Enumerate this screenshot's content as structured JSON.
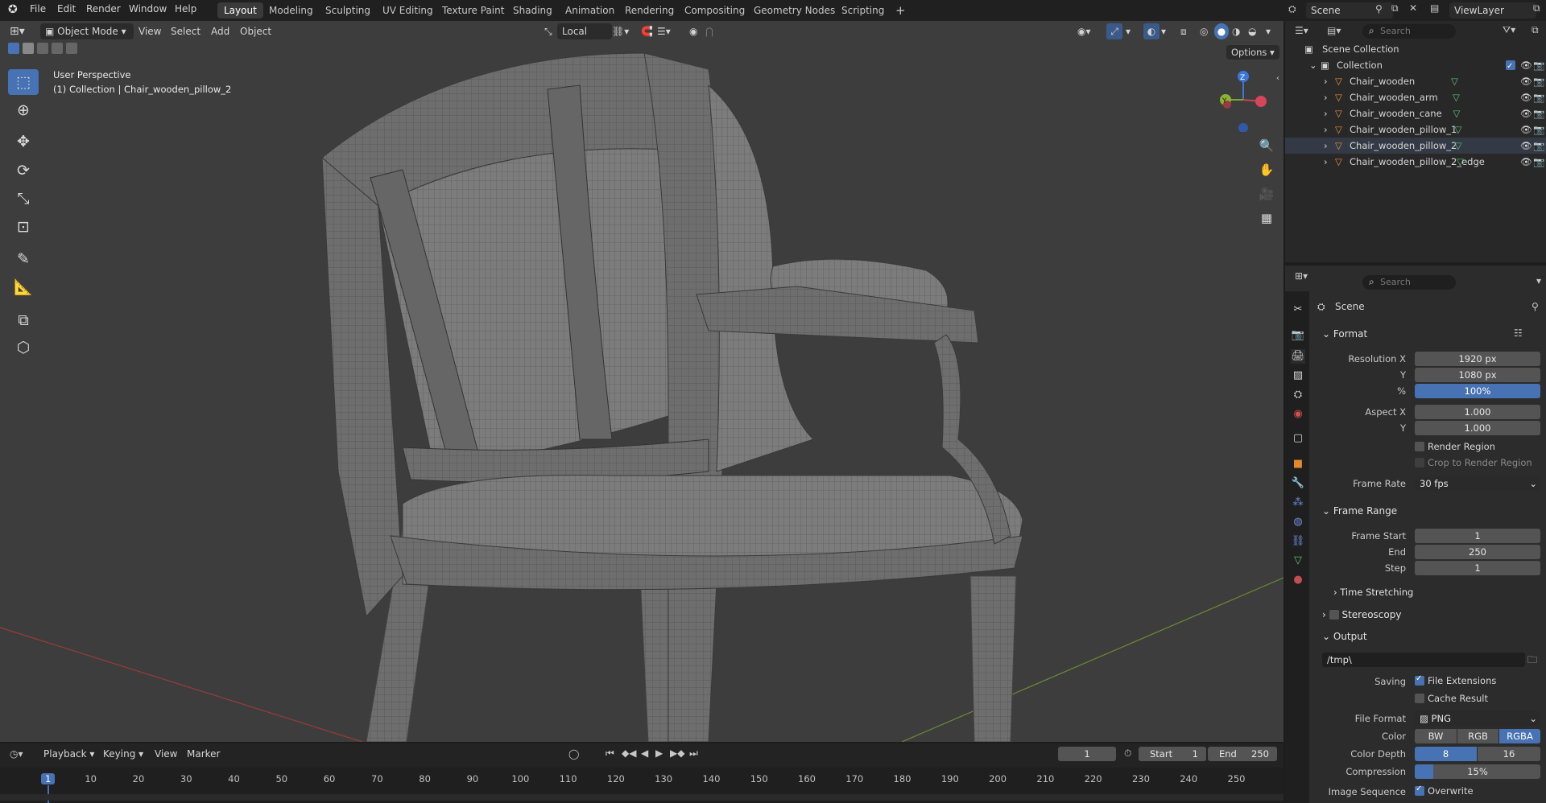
{
  "topbar": {
    "menus": [
      "File",
      "Edit",
      "Render",
      "Window",
      "Help"
    ],
    "workspaces": [
      "Layout",
      "Modeling",
      "Sculpting",
      "UV Editing",
      "Texture Paint",
      "Shading",
      "Animation",
      "Rendering",
      "Compositing",
      "Geometry Nodes",
      "Scripting"
    ],
    "active_workspace": "Layout",
    "add_tab": "+",
    "scene": "Scene",
    "view_layer": "ViewLayer"
  },
  "viewport": {
    "mode": "Object Mode",
    "menus": [
      "View",
      "Select",
      "Add",
      "Object"
    ],
    "transform_orientation": "Local",
    "options": "Options",
    "overlay_line1": "User Perspective",
    "overlay_line2": "(1) Collection | Chair_wooden_pillow_2",
    "gizmo_z": "Z",
    "gizmo_y": "Y"
  },
  "outliner": {
    "search_placeholder": "Search",
    "scene_collection": "Scene Collection",
    "collection": "Collection",
    "objects": [
      "Chair_wooden",
      "Chair_wooden_arm",
      "Chair_wooden_cane",
      "Chair_wooden_pillow_1",
      "Chair_wooden_pillow_2",
      "Chair_wooden_pillow_2_edge"
    ]
  },
  "properties": {
    "search_placeholder": "Search",
    "context": "Scene",
    "format": {
      "title": "Format",
      "resolution_x_label": "Resolution X",
      "resolution_x": "1920 px",
      "y_label": "Y",
      "resolution_y": "1080 px",
      "percent_label": "%",
      "percent": "100%",
      "aspect_x_label": "Aspect X",
      "aspect_x": "1.000",
      "aspect_y_label": "Y",
      "aspect_y": "1.000",
      "render_region": "Render Region",
      "crop_region": "Crop to Render Region",
      "frame_rate_label": "Frame Rate",
      "frame_rate": "30 fps"
    },
    "frame_range": {
      "title": "Frame Range",
      "start_label": "Frame Start",
      "start": "1",
      "end_label": "End",
      "end": "250",
      "step_label": "Step",
      "step": "1"
    },
    "time_stretching": "Time Stretching",
    "stereoscopy": "Stereoscopy",
    "output": {
      "title": "Output",
      "path": "/tmp\\",
      "saving_label": "Saving",
      "file_extensions": "File Extensions",
      "cache_result": "Cache Result",
      "file_format_label": "File Format",
      "file_format": "PNG",
      "color_label": "Color",
      "color_options": [
        "BW",
        "RGB",
        "RGBA"
      ],
      "color_selected": "RGBA",
      "color_depth_label": "Color Depth",
      "color_depth_options": [
        "8",
        "16"
      ],
      "color_depth_selected": "8",
      "compression_label": "Compression",
      "compression": "15%",
      "compression_level": 0.15,
      "image_sequence_label": "Image Sequence",
      "overwrite": "Overwrite"
    }
  },
  "timeline": {
    "menus": [
      "Playback",
      "Keying",
      "View",
      "Marker"
    ],
    "current_frame": "1",
    "start_label": "Start",
    "start": "1",
    "end_label": "End",
    "end": "250",
    "ticks": [
      "1",
      "10",
      "20",
      "30",
      "40",
      "50",
      "60",
      "70",
      "80",
      "90",
      "100",
      "110",
      "120",
      "130",
      "140",
      "150",
      "160",
      "170",
      "180",
      "190",
      "200",
      "210",
      "220",
      "230",
      "240",
      "250"
    ]
  },
  "colors": {
    "accent": "#4772b3",
    "viewport_bg": "#3d3d3d",
    "panel_bg": "#2c2c2c",
    "mesh": "#7a7a7a"
  }
}
